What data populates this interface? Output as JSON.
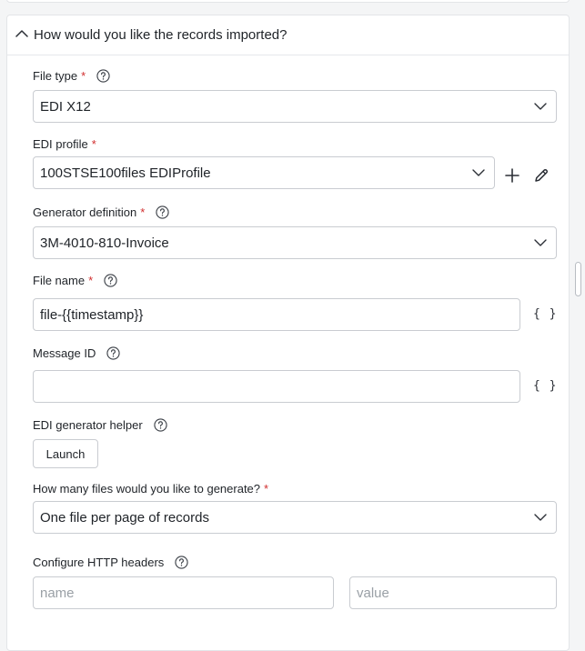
{
  "section": {
    "title": "How would you like the records imported?"
  },
  "file_type": {
    "label": "File type",
    "value": "EDI X12"
  },
  "edi_profile": {
    "label": "EDI profile",
    "value": "100STSE100files EDIProfile"
  },
  "generator_definition": {
    "label": "Generator definition",
    "value": "3M-4010-810-Invoice"
  },
  "file_name": {
    "label": "File name",
    "value": "file-{{timestamp}}",
    "braces": "{ }"
  },
  "message_id": {
    "label": "Message ID",
    "value": "",
    "braces": "{ }"
  },
  "edi_generator_helper": {
    "label": "EDI generator helper",
    "button_label": "Launch"
  },
  "files_count": {
    "label": "How many files would you like to generate?",
    "value": "One file per page of records"
  },
  "http_headers": {
    "label": "Configure HTTP headers",
    "name_placeholder": "name",
    "value_placeholder": "value"
  },
  "required_marker": "*",
  "colors": {
    "required": "#d12e2e",
    "border": "#c9ccd1",
    "text": "#1f2328"
  },
  "icons": {
    "collapse": "chevron-up-icon",
    "help": "help-circle-icon",
    "dropdown": "chevron-down-icon",
    "add": "plus-icon",
    "edit": "pencil-icon"
  }
}
